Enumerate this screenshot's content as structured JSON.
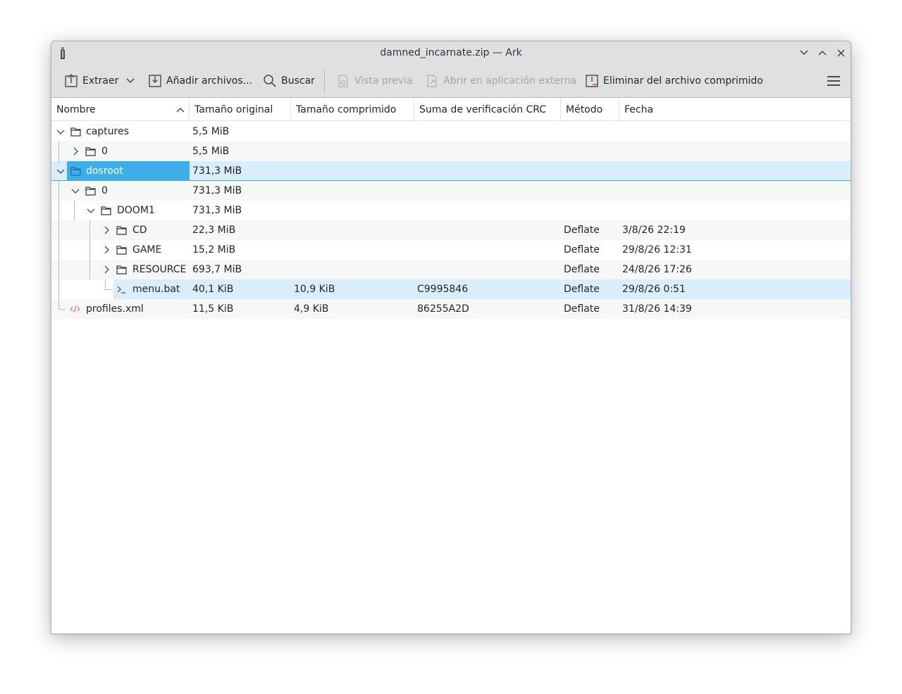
{
  "window": {
    "title": "damned_incarnate.zip — Ark"
  },
  "toolbar": {
    "extract": "Extraer",
    "add_files": "Añadir archivos...",
    "search": "Buscar",
    "preview": "Vista previa",
    "open_external": "Abrir en aplicación externa",
    "delete": "Eliminar del archivo comprimido"
  },
  "columns": {
    "name": "Nombre",
    "original_size": "Tamaño original",
    "compressed_size": "Tamaño comprimido",
    "crc": "Suma de verificación CRC",
    "method": "Método",
    "date": "Fecha"
  },
  "rows": [
    {
      "name": "captures",
      "original": "5,5 MiB",
      "compressed": "",
      "crc": "",
      "method": "",
      "date": "",
      "icon": "folder-icon"
    },
    {
      "name": "0",
      "original": "5,5 MiB",
      "compressed": "",
      "crc": "",
      "method": "",
      "date": "",
      "icon": "folder-icon"
    },
    {
      "name": "dosroot",
      "original": "731,3 MiB",
      "compressed": "",
      "crc": "",
      "method": "",
      "date": "",
      "icon": "folder-icon"
    },
    {
      "name": "0",
      "original": "731,3 MiB",
      "compressed": "",
      "crc": "",
      "method": "",
      "date": "",
      "icon": "folder-icon"
    },
    {
      "name": "DOOM1",
      "original": "731,3 MiB",
      "compressed": "",
      "crc": "",
      "method": "",
      "date": "",
      "icon": "folder-icon"
    },
    {
      "name": "CD",
      "original": "22,3 MiB",
      "compressed": "",
      "crc": "",
      "method": "Deflate",
      "date": "3/8/26 22:19",
      "icon": "folder-icon"
    },
    {
      "name": "GAME",
      "original": "15,2 MiB",
      "compressed": "",
      "crc": "",
      "method": "Deflate",
      "date": "29/8/26 12:31",
      "icon": "folder-icon"
    },
    {
      "name": "RESOURCE",
      "original": "693,7 MiB",
      "compressed": "",
      "crc": "",
      "method": "Deflate",
      "date": "24/8/26 17:26",
      "icon": "folder-icon"
    },
    {
      "name": "menu.bat",
      "original": "40,1 KiB",
      "compressed": "10,9 KiB",
      "crc": "C9995846",
      "method": "Deflate",
      "date": "29/8/26 0:51",
      "icon": "terminal-script-icon"
    },
    {
      "name": "profiles.xml",
      "original": "11,5 KiB",
      "compressed": "4,9 KiB",
      "crc": "86255A2D",
      "method": "Deflate",
      "date": "31/8/26 14:39",
      "icon": "xml-file-icon"
    }
  ],
  "colors": {
    "selection": "#3daee9",
    "selection_row": "#d9edfa",
    "chrome": "#dee0e2"
  }
}
